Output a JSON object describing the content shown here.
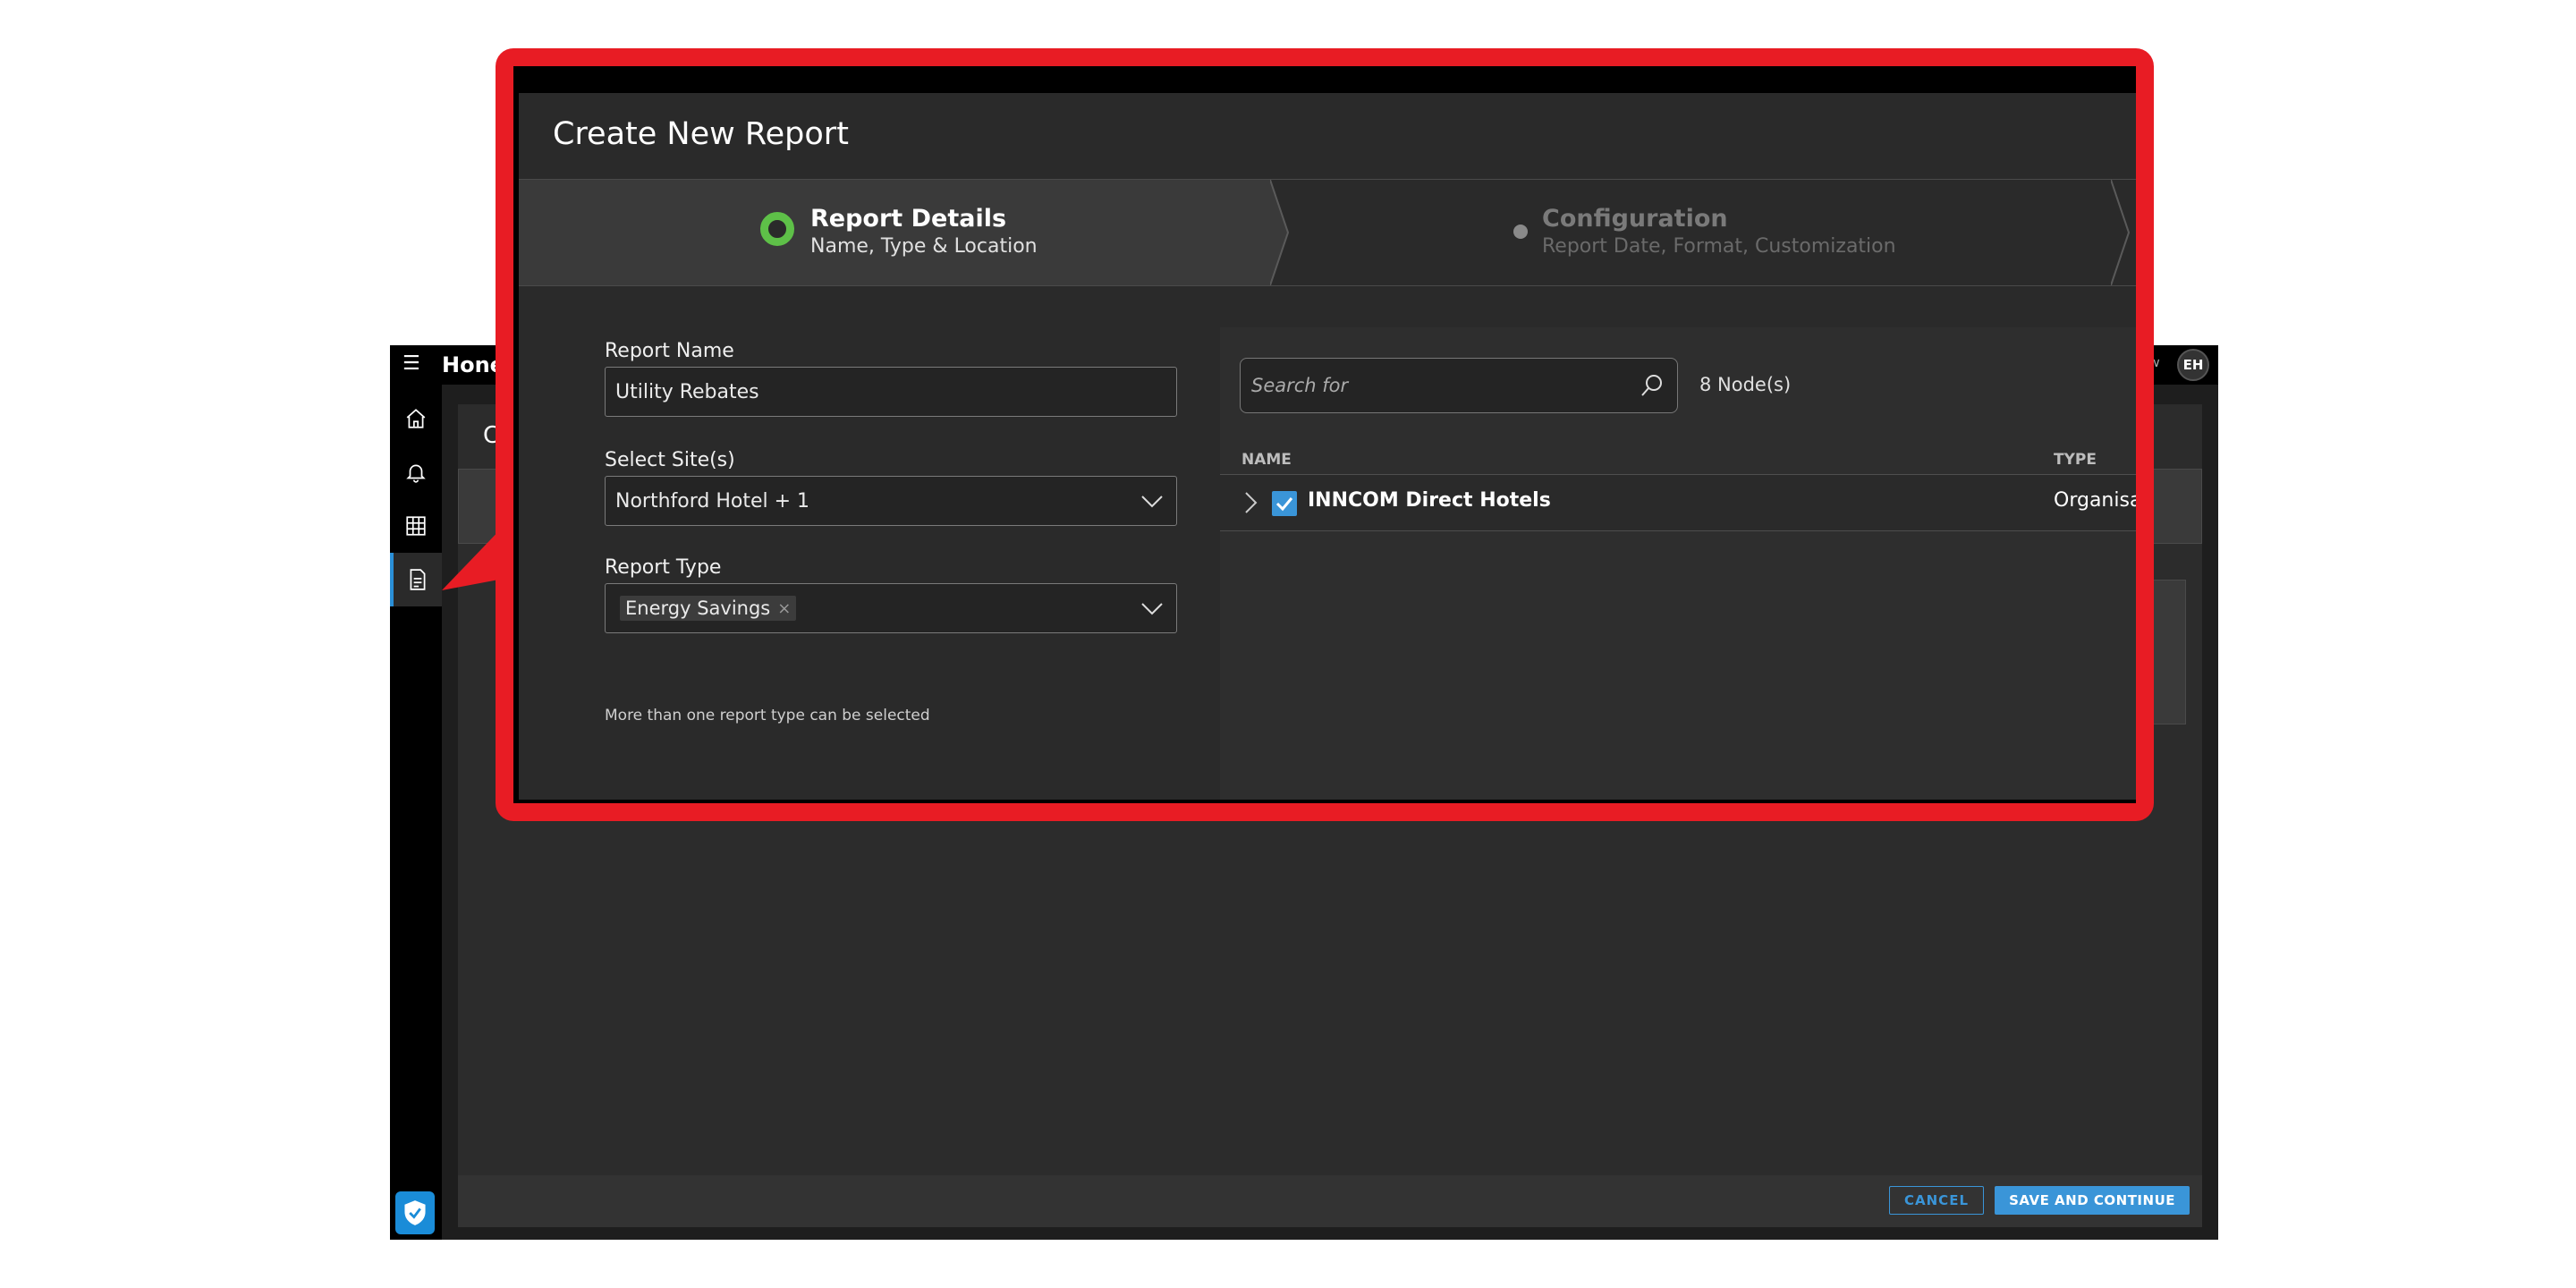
{
  "app": {
    "brand": "Hone",
    "avatar_initials": "EH",
    "bg_title": "C",
    "footer": {
      "cancel_label": "CANCEL",
      "save_label": "SAVE AND CONTINUE"
    },
    "sidebar": [
      "home-icon",
      "bell-icon",
      "grid-icon",
      "report-icon"
    ]
  },
  "dialog": {
    "title": "Create New Report",
    "steps": [
      {
        "title": "Report Details",
        "subtitle": "Name, Type & Location",
        "state": "active"
      },
      {
        "title": "Configuration",
        "subtitle": "Report Date, Format, Customization",
        "state": "pending"
      }
    ],
    "form": {
      "report_name_label": "Report Name",
      "report_name_value": "Utility Rebates",
      "sites_label": "Select Site(s)",
      "sites_value": "Northford Hotel + 1",
      "report_type_label": "Report Type",
      "report_type_chip": "Energy Savings",
      "report_type_helper": "More than one report type can be selected"
    },
    "nodes": {
      "search_placeholder": "Search for",
      "count": "8 Node(s)",
      "col_name": "NAME",
      "col_type": "TYPE",
      "rows": [
        {
          "name": "INNCOM Direct Hotels",
          "type": "Organisa",
          "checked": true
        }
      ]
    }
  },
  "colors": {
    "accent": "#3a95d8",
    "callout": "#e81c24",
    "step_active": "#5ec048"
  }
}
